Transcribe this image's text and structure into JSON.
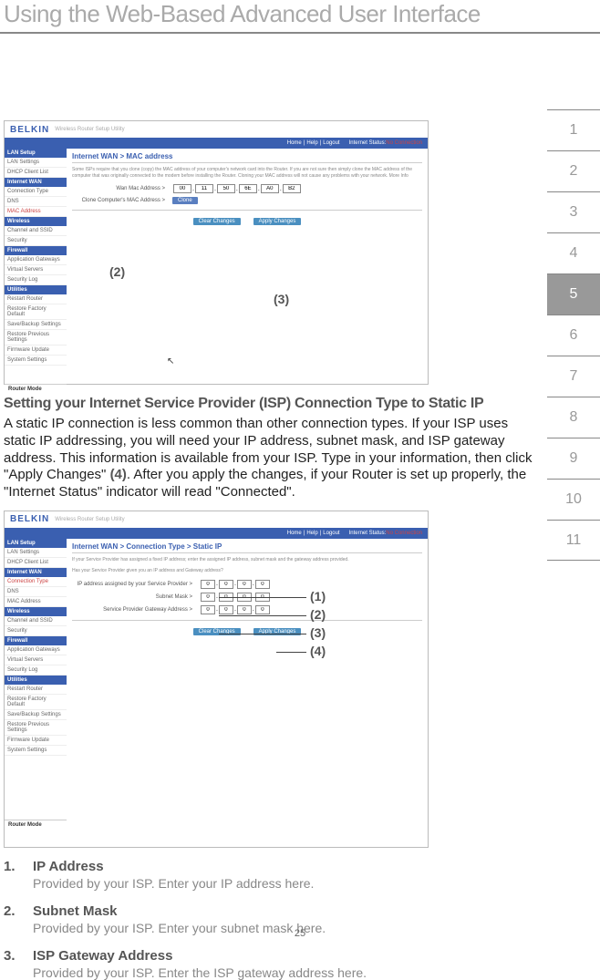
{
  "page_title": "Using the Web-Based Advanced User Interface",
  "page_number": "25",
  "tabs": [
    "1",
    "2",
    "3",
    "4",
    "5",
    "6",
    "7",
    "8",
    "9",
    "10",
    "11"
  ],
  "active_tab_index": 4,
  "screenshot1": {
    "brand": "BELKIN",
    "brand_sub": "Wireless Router Setup Utility",
    "nav": {
      "links": [
        "Home",
        "Help",
        "Logout"
      ],
      "status_label": "Internet Status:",
      "status_value": "No Connection"
    },
    "sidenav": {
      "groups": [
        {
          "header": "LAN Setup",
          "items": [
            "LAN Settings",
            "DHCP Client List"
          ]
        },
        {
          "header": "Internet WAN",
          "items": [
            "Connection Type",
            "DNS",
            "MAC Address"
          ],
          "active_index": 2
        },
        {
          "header": "Wireless",
          "items": [
            "Channel and SSID",
            "Security"
          ]
        },
        {
          "header": "Firewall",
          "items": [
            "Application Gateways",
            "Virtual Servers",
            "Security Log"
          ]
        },
        {
          "header": "Utilities",
          "items": [
            "Restart Router",
            "Restore Factory Default",
            "Save/Backup Settings",
            "Restore Previous Settings",
            "Firmware Update",
            "System Settings"
          ]
        }
      ],
      "footer": "Router Mode"
    },
    "main": {
      "title": "Internet WAN > MAC address",
      "desc": "Some ISPs require that you clone (copy) the MAC address of your computer's network card into the Router. If you are not sure then simply clone the MAC address of the computer that was originally connected to the modem before installing the Router. Cloning your MAC address will not cause any problems with your network. More Info",
      "mac_label": "Wan Mac Address >",
      "mac_values": [
        "00",
        "11",
        "50",
        "",
        "6E",
        "A0",
        "B2"
      ],
      "clone_label": "Clone Computer's MAC Address >",
      "clone_btn": "Clone",
      "clear_btn": "Clear Changes",
      "apply_btn": "Apply Changes"
    },
    "callouts": {
      "c2": "(2)",
      "c3": "(3)"
    }
  },
  "screenshot2": {
    "brand": "BELKIN",
    "brand_sub": "Wireless Router Setup Utility",
    "nav": {
      "links": [
        "Home",
        "Help",
        "Logout"
      ],
      "status_label": "Internet Status:",
      "status_value": "No Connection"
    },
    "sidenav": {
      "groups": [
        {
          "header": "LAN Setup",
          "items": [
            "LAN Settings",
            "DHCP Client List"
          ]
        },
        {
          "header": "Internet WAN",
          "items": [
            "Connection Type",
            "DNS",
            "MAC Address"
          ],
          "active_index": 0
        },
        {
          "header": "Wireless",
          "items": [
            "Channel and SSID",
            "Security"
          ]
        },
        {
          "header": "Firewall",
          "items": [
            "Application Gateways",
            "Virtual Servers",
            "Security Log"
          ]
        },
        {
          "header": "Utilities",
          "items": [
            "Restart Router",
            "Restore Factory Default",
            "Save/Backup Settings",
            "Restore Previous Settings",
            "Firmware Update",
            "System Settings"
          ]
        }
      ],
      "footer": "Router Mode"
    },
    "main": {
      "title": "Internet WAN > Connection Type > Static IP",
      "desc1": "If your Service Provider has assigned a fixed IP address; enter the assigned IP address, subnet mask and the gateway address provided.",
      "desc2": "Has your Service Provider given you an IP address and Gateway address?",
      "rows": [
        {
          "label": "IP address assigned by your Service Provider >",
          "values": [
            "0",
            "0",
            "0",
            "0"
          ]
        },
        {
          "label": "Subnet Mask >",
          "values": [
            "0",
            "0",
            "0",
            "0"
          ]
        },
        {
          "label": "Service Provider Gateway Address >",
          "values": [
            "0",
            "0",
            "0",
            "0"
          ]
        }
      ],
      "clear_btn": "Clear Changes",
      "apply_btn": "Apply Changes"
    },
    "callouts": {
      "c1": "(1)",
      "c2": "(2)",
      "c3": "(3)",
      "c4": "(4)"
    }
  },
  "section_heading": "Setting your Internet Service Provider (ISP) Connection Type to Static IP",
  "body_paragraph_1": "A static IP connection is less common than other connection types. If your ISP uses static IP addressing, you will need your IP address, subnet mask, and ISP gateway address. This information is available from your ISP. Type in your information, then click \"Apply Changes\" ",
  "body_ref_4": "(4)",
  "body_paragraph_2": ". After you apply the changes, if your Router is set up properly, the \"Internet Status\" indicator will read \"Connected\".",
  "list_items": [
    {
      "num": "1.",
      "title": "IP Address",
      "desc": "Provided by your ISP. Enter your IP address here."
    },
    {
      "num": "2.",
      "title": "Subnet Mask",
      "desc": "Provided by your ISP. Enter your subnet mask here."
    },
    {
      "num": "3.",
      "title": "ISP Gateway Address",
      "desc": "Provided by your ISP. Enter the ISP gateway address here."
    }
  ]
}
